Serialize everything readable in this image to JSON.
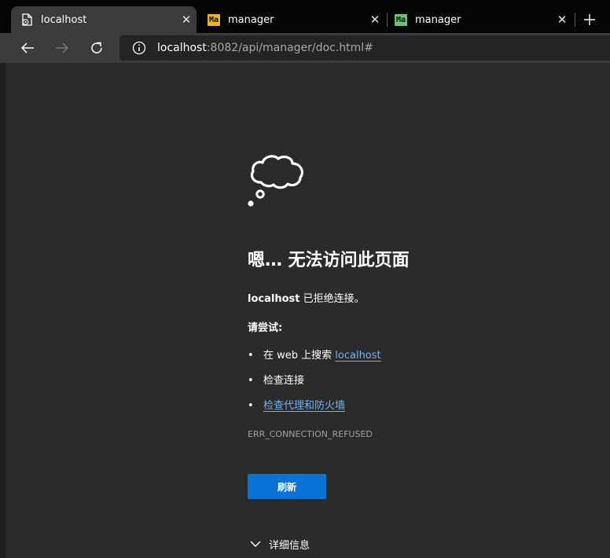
{
  "tabs": [
    {
      "title": "localhost",
      "favicon": "error-page-icon",
      "active": true
    },
    {
      "title": "manager",
      "favicon_text": "Ma",
      "favicon_color": "#e8b33a",
      "active": false
    },
    {
      "title": "manager",
      "favicon_text": "Ma",
      "favicon_color": "#6fbf7a",
      "active": false
    }
  ],
  "toolbar": {
    "url_host": "localhost",
    "url_rest": ":8082/api/manager/doc.html#"
  },
  "error": {
    "heading": "嗯… 无法访问此页面",
    "host": "localhost",
    "message": " 已拒绝连接。",
    "try_label": "请尝试:",
    "suggestion_search_prefix": "在 web 上搜索 ",
    "suggestion_search_link": "localhost",
    "suggestion_check": "检查连接",
    "suggestion_proxy": "检查代理和防火墙",
    "code": "ERR_CONNECTION_REFUSED",
    "refresh_label": "刷新",
    "details_label": "详细信息"
  },
  "colors": {
    "accent": "#0a74d6",
    "link": "#6fb3f2"
  }
}
